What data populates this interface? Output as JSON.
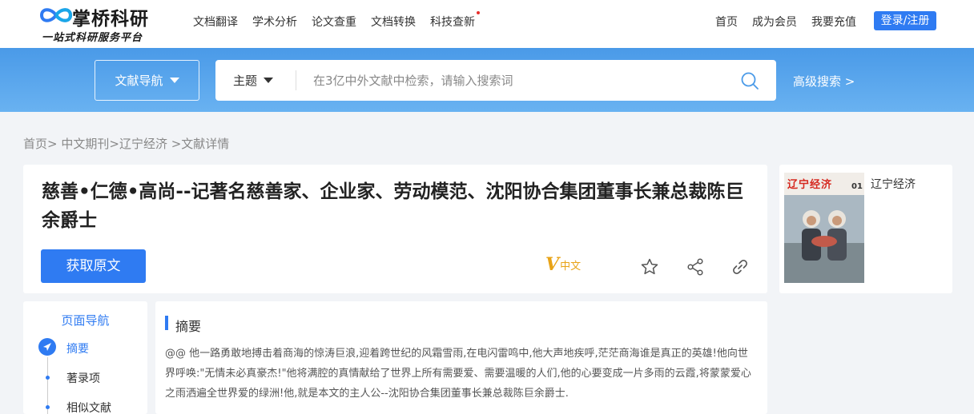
{
  "header": {
    "logo_title": "掌桥科研",
    "logo_subtitle": "一站式科研服务平台",
    "nav": [
      {
        "label": "文档翻译"
      },
      {
        "label": "学术分析"
      },
      {
        "label": "论文查重"
      },
      {
        "label": "文档转换"
      },
      {
        "label": "科技查新",
        "has_dot": true
      }
    ],
    "right_nav": [
      {
        "label": "首页"
      },
      {
        "label": "成为会员"
      },
      {
        "label": "我要充值"
      }
    ],
    "login_label": "登录/注册"
  },
  "search": {
    "doc_nav_label": "文献导航",
    "topic_label": "主题",
    "placeholder": "在3亿中外文献中检索，请输入搜索词",
    "advanced_label": "高级搜索 >"
  },
  "breadcrumb": {
    "home": "首页>",
    "level2": "中文期刊>",
    "level3": "辽宁经济",
    "level4": ">文献详情"
  },
  "article": {
    "title": "慈善•仁德•高尚--记著名慈善家、企业家、劳动模范、沈阳协合集团董事长兼总裁陈巨余爵士",
    "get_button": "获取原文",
    "language_mark": "V",
    "language": "中文",
    "icons": [
      "star-icon",
      "share-icon",
      "link-icon"
    ]
  },
  "journal": {
    "cover_title": "辽宁经济",
    "cover_issue": "01",
    "name": "辽宁经济"
  },
  "side_nav": {
    "title": "页面导航",
    "items": [
      {
        "label": "摘要",
        "active": true
      },
      {
        "label": "著录项"
      },
      {
        "label": "相似文献"
      }
    ]
  },
  "abstract": {
    "heading": "摘要",
    "text": "@@ 他一路勇敢地搏击着商海的惊涛巨浪,迎着跨世纪的风霜雪雨,在电闪雷鸣中,他大声地疾呼,茫茫商海谁是真正的英雄!他向世界呼唤:\"无情未必真豪杰!\"他将满腔的真情献给了世界上所有需要爱、需要温暖的人们,他的心要变成一片多雨的云霞,将蒙蒙爱心之雨洒遍全世界爱的绿洲!他,就是本文的主人公--沈阳协合集团董事长兼总裁陈巨余爵士."
  },
  "colors": {
    "primary": "#2f7bf2",
    "banner_top": "#4a9ae8",
    "banner_bottom": "#69b2f1",
    "accent_gold": "#e8a317",
    "page_bg": "#f2f4f7"
  }
}
